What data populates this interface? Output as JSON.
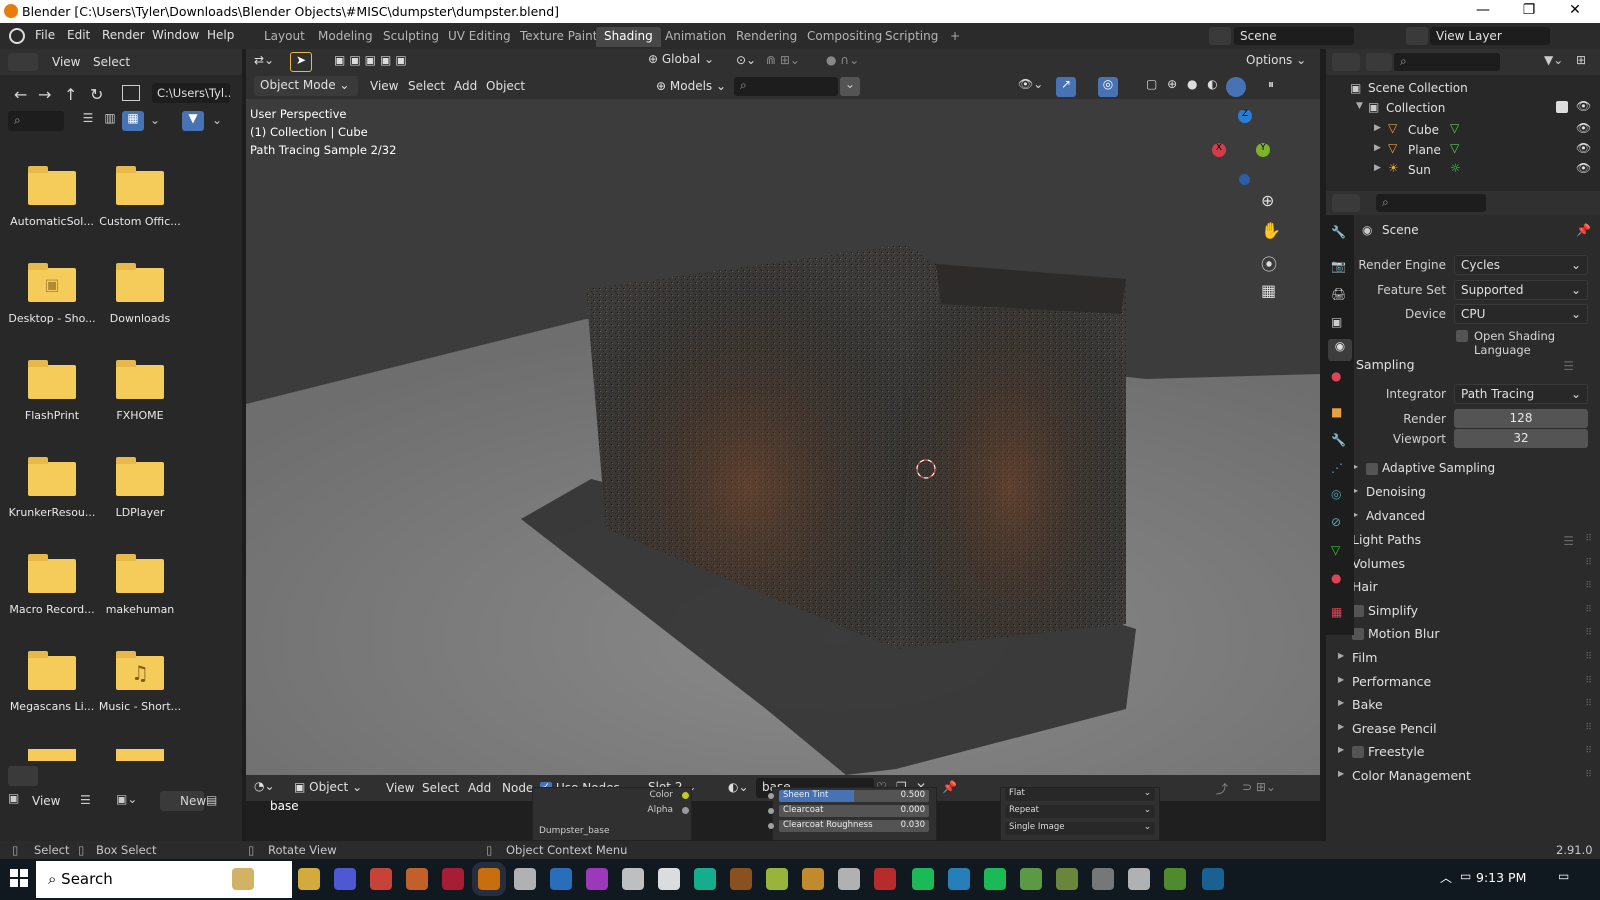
{
  "window": {
    "title": "Blender [C:\\Users\\Tyler\\Downloads\\Blender Objects\\#MISC\\dumpster\\dumpster.blend]",
    "controls": [
      "—",
      "❐",
      "✕"
    ]
  },
  "menu": [
    "File",
    "Edit",
    "Render",
    "Window",
    "Help"
  ],
  "workspaces": [
    "Layout",
    "Modeling",
    "Sculpting",
    "UV Editing",
    "Texture Paint",
    "Shading",
    "Animation",
    "Rendering",
    "Compositing",
    "Scripting"
  ],
  "active_workspace": "Shading",
  "scene_name": "Scene",
  "view_layer": "View Layer",
  "filebrowser": {
    "menu": [
      "View",
      "Select"
    ],
    "path": "C:\\Users\\Tyl...",
    "items": [
      {
        "name": "AutomaticSol...",
        "type": "folder"
      },
      {
        "name": "Custom Offic...",
        "type": "folder"
      },
      {
        "name": "Desktop - Sho...",
        "type": "shortcut"
      },
      {
        "name": "Downloads",
        "type": "folder"
      },
      {
        "name": "FlashPrint",
        "type": "folder"
      },
      {
        "name": "FXHOME",
        "type": "folder"
      },
      {
        "name": "KrunkerResou...",
        "type": "folder"
      },
      {
        "name": "LDPlayer",
        "type": "folder"
      },
      {
        "name": "Macro Record...",
        "type": "folder"
      },
      {
        "name": "makehuman",
        "type": "folder"
      },
      {
        "name": "Megascans Li...",
        "type": "folder"
      },
      {
        "name": "Music - Short...",
        "type": "music"
      }
    ],
    "bottom": {
      "view": "View",
      "new": "New"
    }
  },
  "viewport": {
    "transform": "Global",
    "mode": "Object Mode",
    "menu": [
      "View",
      "Select",
      "Add",
      "Object"
    ],
    "collection_filter": "Models",
    "options": "Options",
    "overlay_lines": [
      "User Perspective",
      "(1) Collection | Cube",
      "Path Tracing Sample 2/32"
    ],
    "gizmo": {
      "x": "X",
      "y": "Y",
      "z": "Z"
    }
  },
  "outliner": {
    "root": "Scene Collection",
    "collection": "Collection",
    "objects": [
      "Cube",
      "Plane",
      "Sun"
    ]
  },
  "properties": {
    "context": "Scene",
    "render_engine_label": "Render Engine",
    "render_engine": "Cycles",
    "feature_set_label": "Feature Set",
    "feature_set": "Supported",
    "device_label": "Device",
    "device": "CPU",
    "osl": "Open Shading Language",
    "sampling": "Sampling",
    "integrator_label": "Integrator",
    "integrator": "Path Tracing",
    "render_label": "Render",
    "render_samples": "128",
    "viewport_label": "Viewport",
    "viewport_samples": "32",
    "subsections": [
      "Adaptive Sampling",
      "Denoising",
      "Advanced"
    ],
    "sections": [
      "Light Paths",
      "Volumes",
      "Hair",
      "Simplify",
      "Motion Blur",
      "Film",
      "Performance",
      "Bake",
      "Grease Pencil",
      "Freestyle",
      "Color Management"
    ]
  },
  "node_editor": {
    "type": "Object",
    "menu": [
      "View",
      "Select",
      "Add",
      "Node"
    ],
    "use_nodes": "Use Nodes",
    "slot": "Slot 2",
    "material": "base",
    "label": "base",
    "socket_color": "Color",
    "socket_alpha": "Alpha",
    "node_name": "Dumpster_base",
    "fields": [
      {
        "name": "Sheen Tint",
        "value": "0.500"
      },
      {
        "name": "Clearcoat",
        "value": "0.000"
      },
      {
        "name": "Clearcoat Roughness",
        "value": "0.030"
      }
    ],
    "dropdowns": [
      "Flat",
      "Repeat",
      "Single Image"
    ]
  },
  "status": {
    "select": "Select",
    "box_select": "Box Select",
    "rotate": "Rotate View",
    "context_menu": "Object Context Menu",
    "version": "2.91.0"
  },
  "taskbar": {
    "search": "Search",
    "time": "9:13 PM"
  },
  "colors": {
    "accent": "#4772b3",
    "active_tab": "#474747",
    "folder": "#f5cc5a"
  }
}
